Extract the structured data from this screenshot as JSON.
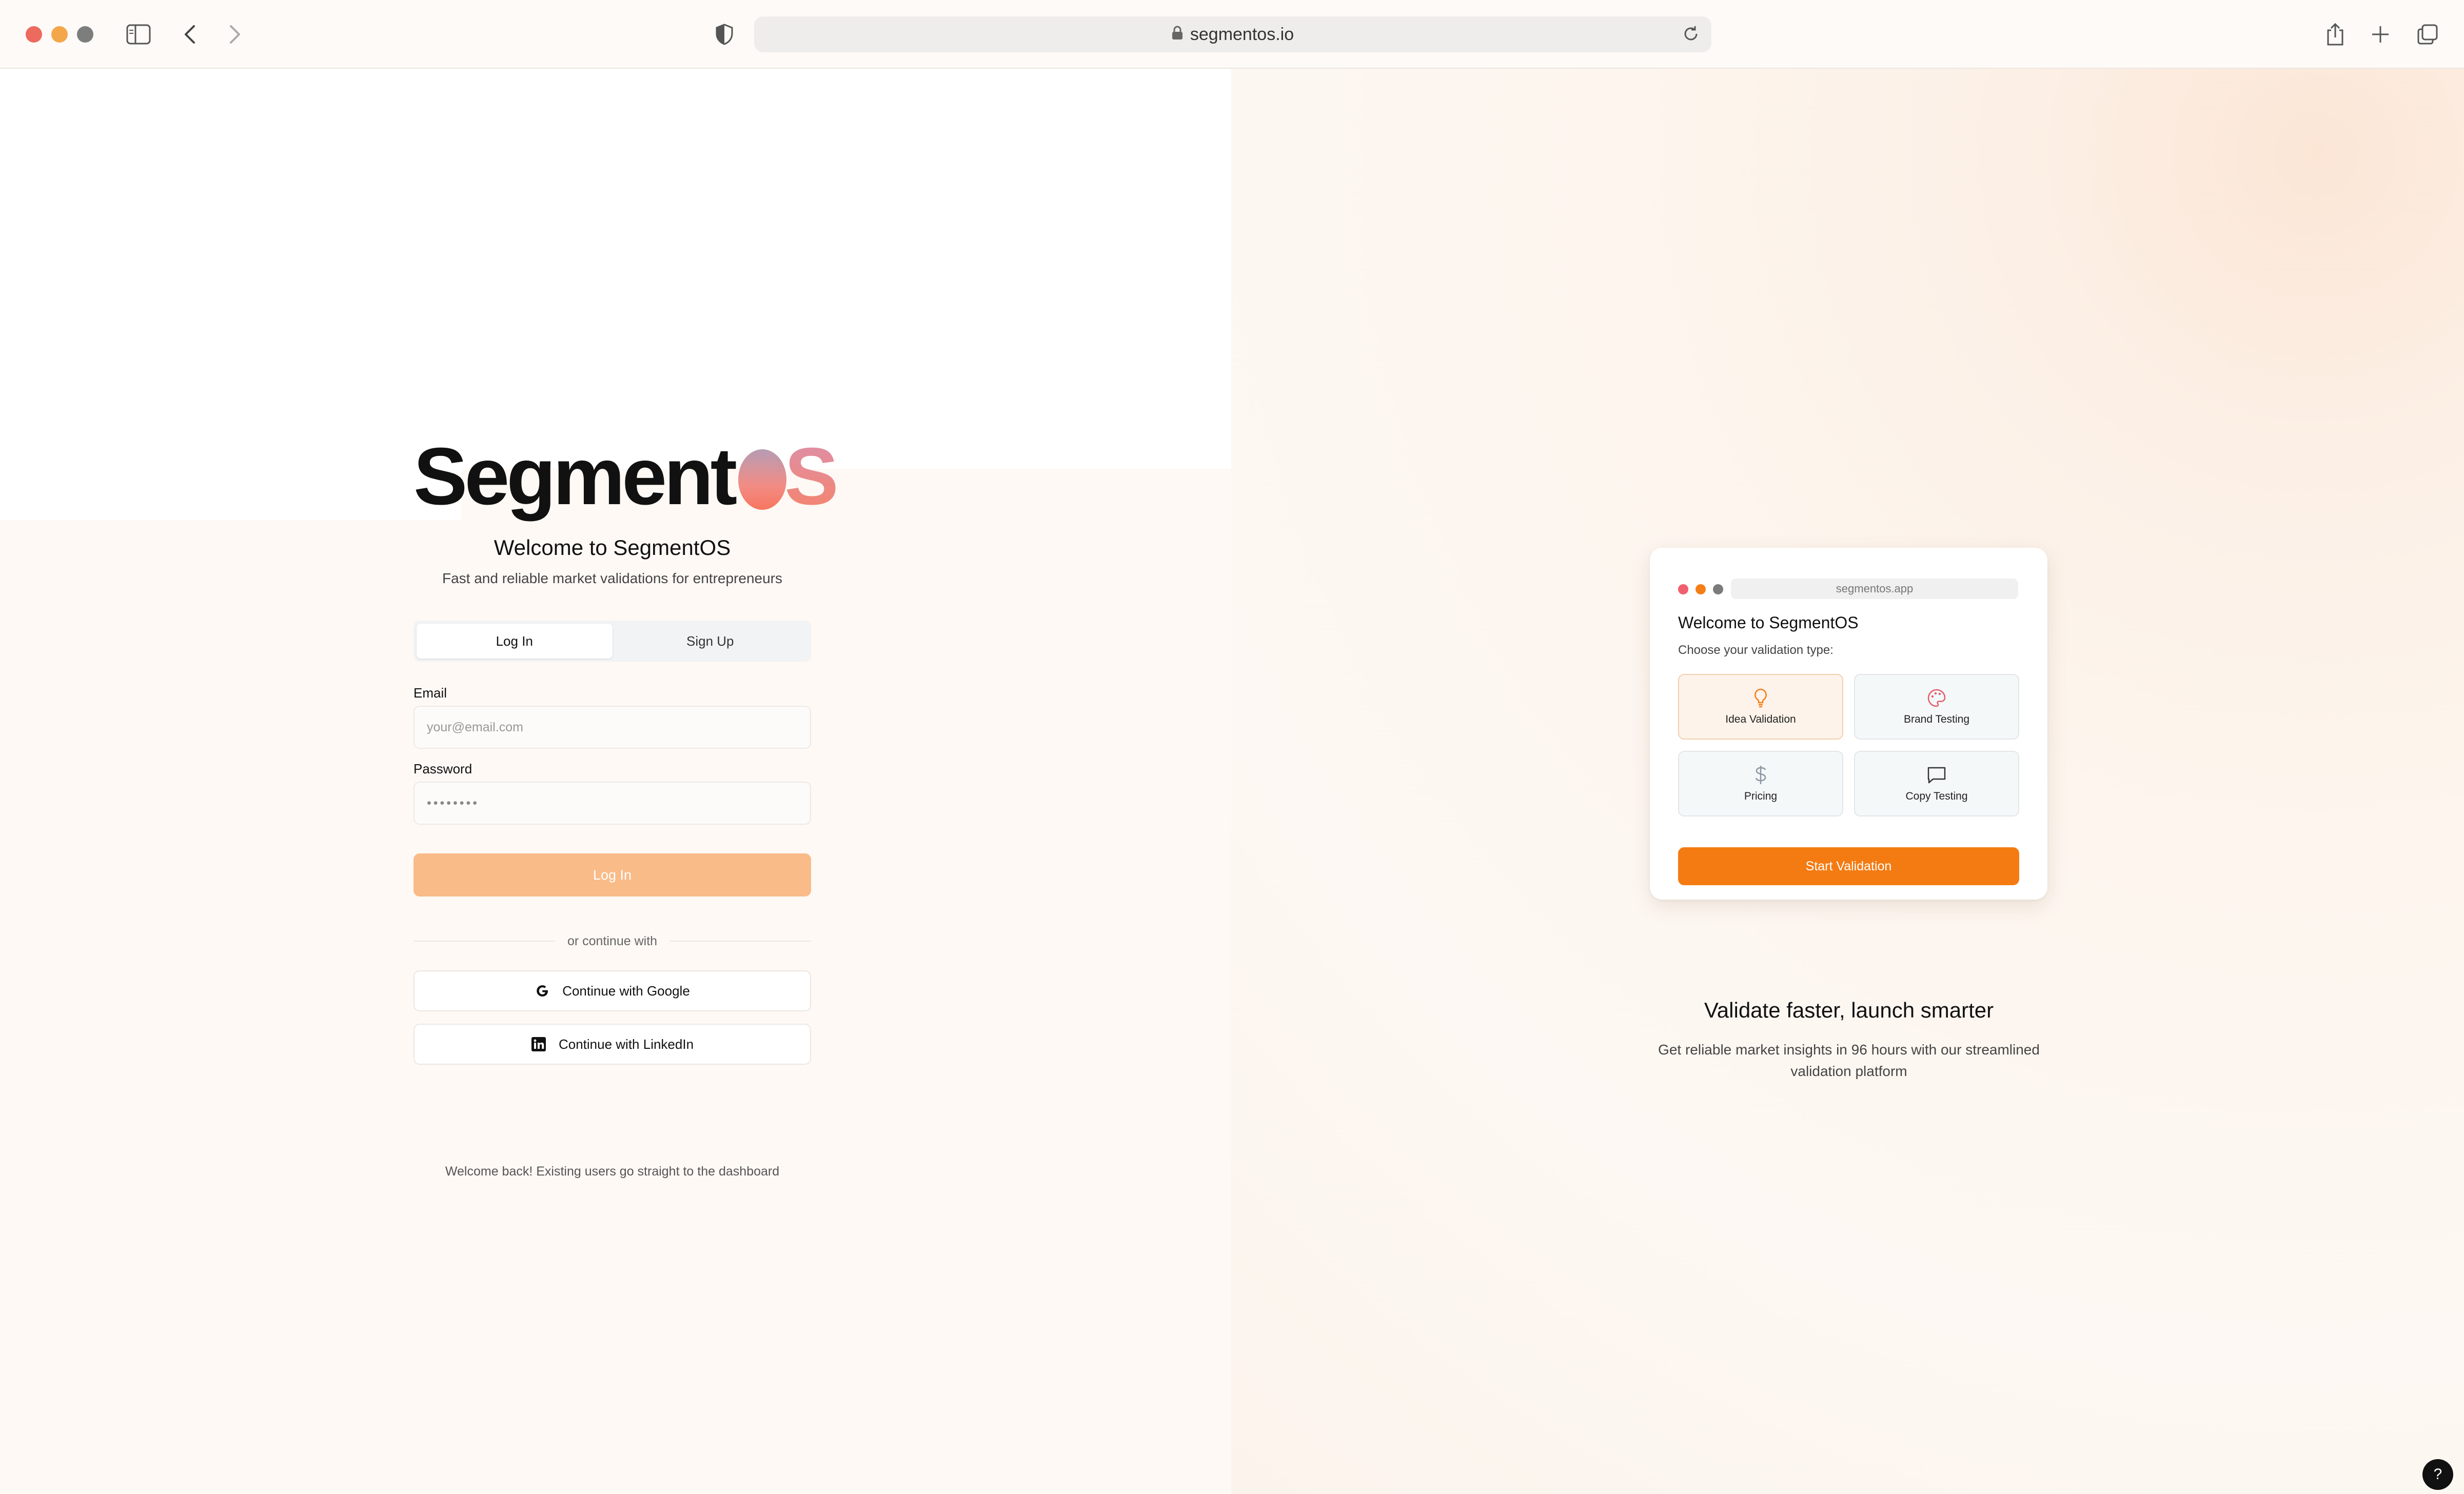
{
  "browser": {
    "url": "segmentos.io",
    "icons": [
      "sidebar-icon",
      "back-icon",
      "forward-icon",
      "shield-icon",
      "lock-icon",
      "reload-icon",
      "share-icon",
      "new-tab-icon",
      "tabs-overview-icon"
    ]
  },
  "login": {
    "logo_main": "Segment",
    "logo_suffix_o": "O",
    "logo_suffix_s": "S",
    "welcome": "Welcome to SegmentOS",
    "tagline": "Fast and reliable market validations for entrepreneurs",
    "tabs": [
      {
        "label": "Log In",
        "active": true
      },
      {
        "label": "Sign Up",
        "active": false
      }
    ],
    "email_label": "Email",
    "email_placeholder": "your@email.com",
    "password_label": "Password",
    "password_value": "••••••••",
    "login_button": "Log In",
    "divider_text": "or continue with",
    "google_button": "Continue with Google",
    "linkedin_button": "Continue with LinkedIn",
    "footnote": "Welcome back! Existing users go straight to the dashboard"
  },
  "preview": {
    "url": "segmentos.app",
    "title": "Welcome to SegmentOS",
    "subtitle": "Choose your validation type:",
    "options": [
      {
        "label": "Idea Validation",
        "icon": "lightbulb-icon",
        "selected": true
      },
      {
        "label": "Brand Testing",
        "icon": "palette-icon",
        "selected": false
      },
      {
        "label": "Pricing",
        "icon": "dollar-icon",
        "selected": false
      },
      {
        "label": "Copy Testing",
        "icon": "message-icon",
        "selected": false
      }
    ],
    "start_button": "Start Validation"
  },
  "promo": {
    "title": "Validate faster, launch smarter",
    "text": "Get reliable market insights in 96 hours with our streamlined validation platform"
  },
  "help_label": "?",
  "colors": {
    "accent": "#f47b12",
    "login_button_disabled": "#f9bb88",
    "page_bg": "#fef9f5"
  }
}
